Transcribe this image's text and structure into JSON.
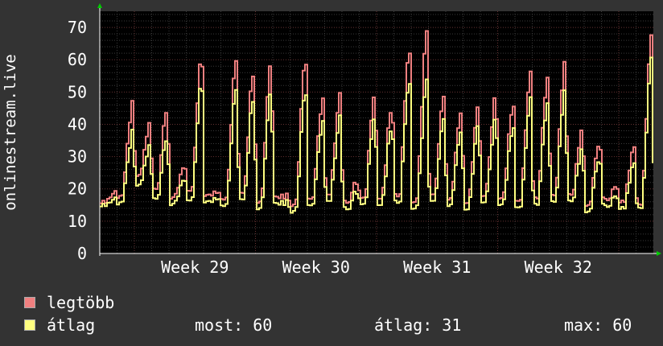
{
  "chart_data": {
    "type": "line",
    "ylabel": "onlinestream.live",
    "ylim": [
      0,
      75
    ],
    "y_ticks": [
      0,
      10,
      20,
      30,
      40,
      50,
      60,
      70
    ],
    "x_tick_labels": [
      "Week 29",
      "Week 30",
      "Week 31",
      "Week 32"
    ],
    "grid": true,
    "days": 32,
    "series": [
      {
        "name": "legtöbb",
        "color": "#f08080",
        "daily_peaks": [
          19,
          46,
          40,
          46,
          28,
          61,
          20,
          60,
          57,
          60,
          18,
          62,
          48,
          50,
          22,
          51,
          46,
          64,
          68,
          48,
          44,
          45,
          50,
          47,
          55,
          56,
          60,
          39,
          35,
          20,
          33,
          67
        ],
        "daily_lows": [
          16,
          18,
          24,
          20,
          17,
          19,
          18,
          17,
          19,
          16,
          18,
          15,
          17,
          18,
          16,
          17,
          17,
          18,
          16,
          18,
          17,
          16,
          18,
          17,
          16,
          17,
          18,
          18,
          15,
          17,
          16,
          15
        ]
      },
      {
        "name": "átlag",
        "color": "#ffff80",
        "daily_peaks": [
          17,
          37,
          33,
          37,
          24,
          53,
          18,
          51,
          49,
          51,
          16,
          52,
          41,
          43,
          19,
          44,
          40,
          54,
          53,
          41,
          38,
          39,
          43,
          40,
          47,
          48,
          51,
          33,
          30,
          17,
          28,
          60
        ],
        "daily_lows": [
          15,
          16,
          21,
          17,
          15,
          16,
          16,
          15,
          17,
          14,
          16,
          13,
          15,
          16,
          14,
          15,
          15,
          16,
          14,
          16,
          15,
          14,
          16,
          15,
          14,
          15,
          16,
          16,
          13,
          15,
          14,
          14
        ]
      }
    ]
  },
  "legend": [
    {
      "label": "legtöbb",
      "color": "#f08080"
    },
    {
      "label": "átlag",
      "color": "#ffff80"
    }
  ],
  "stats": {
    "now_text": "most: 60",
    "avg_text": "átlag: 31",
    "max_text": "max: 60"
  }
}
